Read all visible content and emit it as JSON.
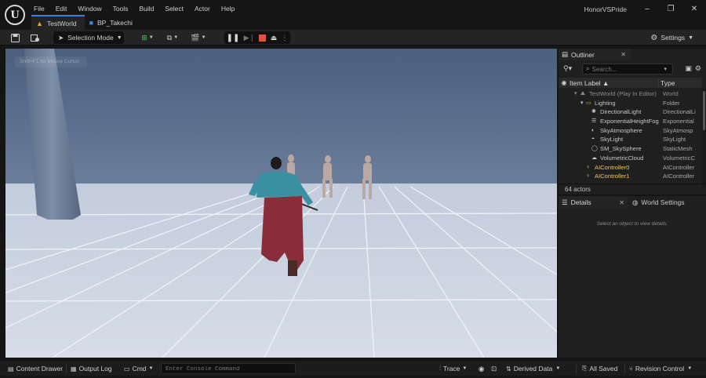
{
  "app": {
    "project_name": "HonorVSPride",
    "logo_text": "U",
    "window_controls": [
      "–",
      "❐",
      "✕"
    ]
  },
  "menu": [
    "File",
    "Edit",
    "Window",
    "Tools",
    "Build",
    "Select",
    "Actor",
    "Help"
  ],
  "tabs": [
    {
      "label": "TestWorld",
      "icon": "level-warning-icon"
    },
    {
      "label": "BP_Takechi",
      "icon": "blueprint-icon"
    }
  ],
  "toolbar": {
    "mode_label": "Selection Mode",
    "settings_label": "Settings"
  },
  "viewport": {
    "hint": "Shift+F1 for Mouse Cursor"
  },
  "outliner": {
    "tab_label": "Outliner",
    "search_placeholder": "Search...",
    "col_label": "Item Label ▲",
    "col_type": "Type",
    "rows": [
      {
        "label": "TestWorld (Play In Editor)",
        "type": "World"
      },
      {
        "label": "Lighting",
        "type": "Folder"
      },
      {
        "label": "DirectionalLight",
        "type": "DirectionalLi"
      },
      {
        "label": "ExponentialHeightFog",
        "type": "Exponential"
      },
      {
        "label": "SkyAtmosphere",
        "type": "SkyAtmosp"
      },
      {
        "label": "SkyLight",
        "type": "SkyLight"
      },
      {
        "label": "SM_SkySphere",
        "type": "StaticMesh"
      },
      {
        "label": "VolumetricCloud",
        "type": "VolumetricC"
      },
      {
        "label": "AIController0",
        "type": "AIController"
      },
      {
        "label": "AIController1",
        "type": "AIController"
      }
    ],
    "actor_count": "64 actors"
  },
  "details": {
    "tab_label": "Details",
    "world_settings_label": "World Settings",
    "empty_hint": "Select an object to view details."
  },
  "bottombar": {
    "content_drawer": "Content Drawer",
    "output_log": "Output Log",
    "cmd": "Cmd",
    "console_placeholder": "Enter Console Command",
    "trace": "Trace",
    "derived_data": "Derived Data",
    "all_saved": "All Saved",
    "revision_control": "Revision Control"
  },
  "colors": {
    "accent": "#3b7fd9",
    "stop": "#e0533b",
    "ai_actor": "#e8c85a"
  }
}
